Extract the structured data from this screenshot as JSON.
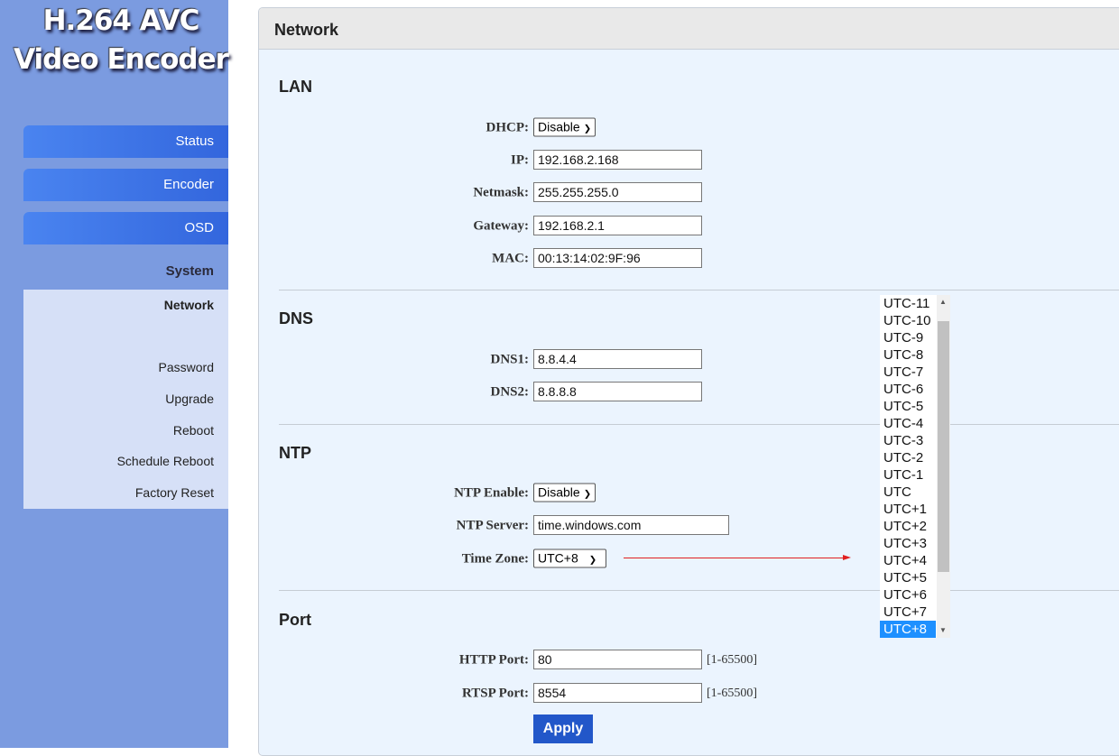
{
  "logo": {
    "line1": "H.264 AVC",
    "line2": "Video Encoder"
  },
  "nav": {
    "status": "Status",
    "encoder": "Encoder",
    "osd": "OSD",
    "system": "System",
    "sub": [
      "Network",
      "Password",
      "Upgrade",
      "Reboot",
      "Schedule Reboot",
      "Factory Reset"
    ]
  },
  "panel": {
    "title": "Network"
  },
  "lan": {
    "heading": "LAN",
    "dhcp_label": "DHCP:",
    "dhcp": "Disable",
    "ip_label": "IP:",
    "ip": "192.168.2.168",
    "netmask_label": "Netmask:",
    "netmask": "255.255.255.0",
    "gateway_label": "Gateway:",
    "gateway": "192.168.2.1",
    "mac_label": "MAC:",
    "mac": "00:13:14:02:9F:96"
  },
  "dns": {
    "heading": "DNS",
    "dns1_label": "DNS1:",
    "dns1": "8.8.4.4",
    "dns2_label": "DNS2:",
    "dns2": "8.8.8.8"
  },
  "ntp": {
    "heading": "NTP",
    "enable_label": "NTP Enable:",
    "enable": "Disable",
    "server_label": "NTP Server:",
    "server": "time.windows.com",
    "tz_label": "Time Zone:",
    "tz": "UTC+8",
    "tz_options": [
      "UTC-11",
      "UTC-10",
      "UTC-9",
      "UTC-8",
      "UTC-7",
      "UTC-6",
      "UTC-5",
      "UTC-4",
      "UTC-3",
      "UTC-2",
      "UTC-1",
      "UTC",
      "UTC+1",
      "UTC+2",
      "UTC+3",
      "UTC+4",
      "UTC+5",
      "UTC+6",
      "UTC+7",
      "UTC+8"
    ]
  },
  "port": {
    "heading": "Port",
    "http_label": "HTTP Port:",
    "http": "80",
    "rtsp_label": "RTSP Port:",
    "rtsp": "8554",
    "range": "[1-65500]",
    "apply": "Apply"
  },
  "colors": {
    "sidebar": "#7b9be0",
    "nav_button": "#3d74e8",
    "apply": "#2257c9",
    "selected_option": "#1e90ff",
    "arrow": "#e02020"
  }
}
